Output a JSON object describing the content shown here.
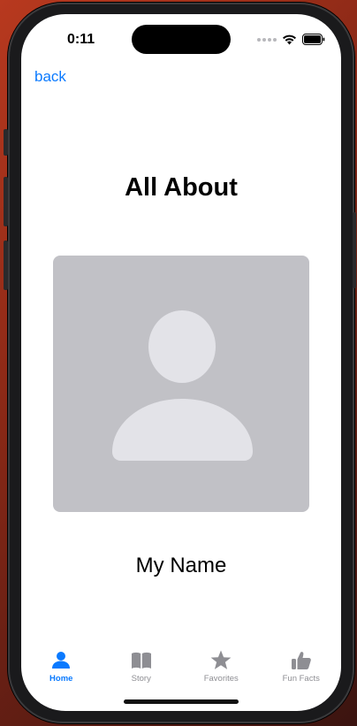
{
  "status_bar": {
    "time": "0:11",
    "icons": [
      "cellular-signal-icon",
      "wifi-icon",
      "battery-icon"
    ]
  },
  "nav": {
    "back_label": "back"
  },
  "page": {
    "title": "All About",
    "photo_icon": "person-placeholder-icon",
    "name": "My Name"
  },
  "tabbar": {
    "tabs": [
      {
        "label": "Home",
        "icon": "person-icon",
        "selected": true
      },
      {
        "label": "Story",
        "icon": "book-icon",
        "selected": false
      },
      {
        "label": "Favorites",
        "icon": "star-icon",
        "selected": false
      },
      {
        "label": "Fun Facts",
        "icon": "thumbs-up-icon",
        "selected": false
      }
    ]
  },
  "colors": {
    "accent": "#0a7aff",
    "tab_inactive": "#8e8e93",
    "placeholder_bg": "#c1c1c6",
    "placeholder_fg": "#e3e3e8"
  }
}
